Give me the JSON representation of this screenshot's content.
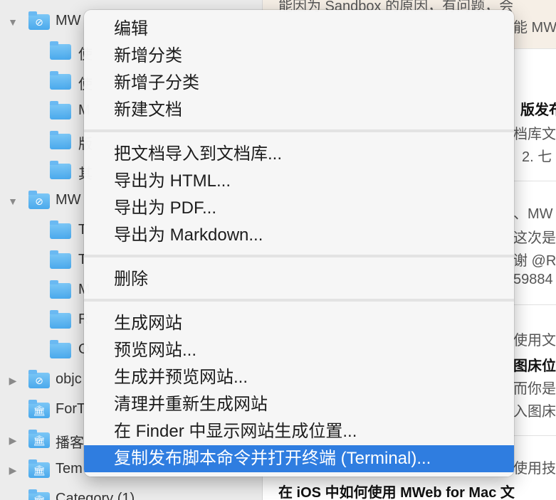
{
  "sidebar": {
    "items": [
      {
        "label": "MW",
        "type": "safari",
        "level": 0,
        "disclosure": "▼"
      },
      {
        "label": "使",
        "type": "folder",
        "level": 1
      },
      {
        "label": "使",
        "type": "folder",
        "level": 1
      },
      {
        "label": "M",
        "type": "folder",
        "level": 1
      },
      {
        "label": "版",
        "type": "folder",
        "level": 1
      },
      {
        "label": "其",
        "type": "folder",
        "level": 1
      },
      {
        "label": "MW",
        "type": "safari",
        "level": 0,
        "disclosure": "▼"
      },
      {
        "label": "T",
        "type": "folder",
        "level": 1
      },
      {
        "label": "T",
        "type": "folder",
        "level": 1
      },
      {
        "label": "M",
        "type": "folder",
        "level": 1
      },
      {
        "label": "R",
        "type": "folder",
        "level": 1
      },
      {
        "label": "O",
        "type": "folder",
        "level": 1
      },
      {
        "label": "objc",
        "type": "safari",
        "level": 0,
        "disclosure": "▶"
      },
      {
        "label": "ForT",
        "type": "bank",
        "level": 0,
        "disclosure": ""
      },
      {
        "label": "播客",
        "type": "bank",
        "level": 0,
        "disclosure": "▶"
      },
      {
        "label": "Tem",
        "type": "bank",
        "level": 0,
        "disclosure": "▶"
      },
      {
        "label": "Category (1)",
        "type": "bank",
        "level": 0,
        "disclosure": ""
      }
    ]
  },
  "doclist": {
    "fragments": [
      {
        "text": "能因为 Sandbox 的原因，有问题，会",
        "bold": false
      },
      {
        "text": "能 MW",
        "bold": false
      },
      {
        "text": "版发布",
        "bold": true
      },
      {
        "text": "档库文",
        "bold": false
      },
      {
        "text": "2. 七",
        "bold": false
      },
      {
        "text": "、MW",
        "bold": false
      },
      {
        "text": "这次是",
        "bold": false
      },
      {
        "text": "谢 @Ro",
        "bold": false
      },
      {
        "text": "59884",
        "bold": false
      },
      {
        "text": "使用文",
        "bold": false
      },
      {
        "text": "图床位",
        "bold": true
      },
      {
        "text": "而你是把",
        "bold": false
      },
      {
        "text": "入图床",
        "bold": false
      },
      {
        "text": "使用技巧",
        "bold": false
      },
      {
        "text": "在 iOS 中如何使用 MWeb for Mac 文",
        "bold": true
      }
    ]
  },
  "menu": {
    "groups": [
      [
        "编辑",
        "新增分类",
        "新增子分类",
        "新建文档"
      ],
      [
        "把文档导入到文档库...",
        "导出为 HTML...",
        "导出为 PDF...",
        "导出为 Markdown..."
      ],
      [
        "删除"
      ],
      [
        "生成网站",
        "预览网站...",
        "生成并预览网站...",
        "清理并重新生成网站",
        "在 Finder 中显示网站生成位置...",
        "复制发布脚本命令并打开终端 (Terminal)..."
      ]
    ],
    "highlighted": "复制发布脚本命令并打开终端 (Terminal)..."
  },
  "colors": {
    "highlight": "#2f7de0",
    "folder": "#4aa9ec",
    "sidebar_bg": "#ececec",
    "menu_bg": "#f6f6f6"
  }
}
